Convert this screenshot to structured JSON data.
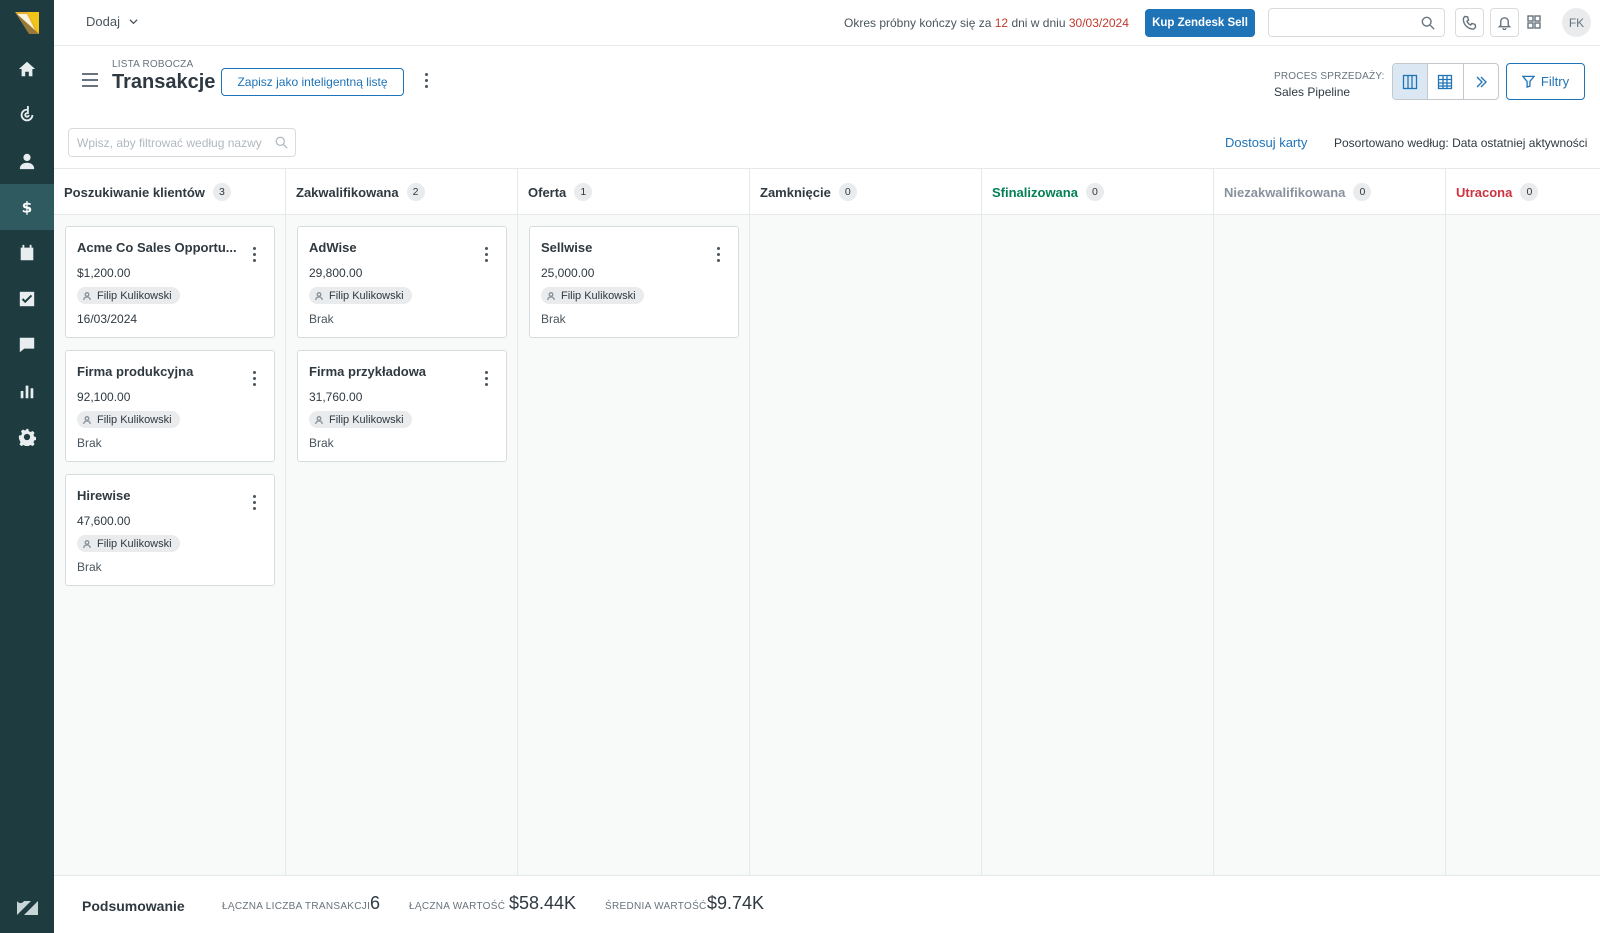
{
  "topbar": {
    "add_label": "Dodaj",
    "trial_prefix": "Okres próbny kończy się za",
    "trial_days": "12",
    "trial_mid": "dni w dniu",
    "trial_date": "30/03/2024",
    "buy_label": "Kup Zendesk Sell",
    "search_placeholder": "",
    "avatar_initials": "FK"
  },
  "header": {
    "kicker": "LISTA ROBOCZA",
    "title": "Transakcje",
    "save_label": "Zapisz jako inteligentną listę",
    "process_label": "PROCES SPRZEDAŻY:",
    "process_value": "Sales Pipeline",
    "filters_label": "Filtry"
  },
  "toolbar": {
    "filter_placeholder": "Wpisz, aby filtrować według nazwy",
    "customize_label": "Dostosuj karty",
    "sorted_label": "Posortowano według: Data ostatniej aktywności"
  },
  "columns": [
    {
      "name": "Poszukiwanie klientów",
      "count": "3",
      "color": "#2f3941"
    },
    {
      "name": "Zakwalifikowana",
      "count": "2",
      "color": "#2f3941"
    },
    {
      "name": "Oferta",
      "count": "1",
      "color": "#2f3941"
    },
    {
      "name": "Zamknięcie",
      "count": "0",
      "color": "#2f3941"
    },
    {
      "name": "Sfinalizowana",
      "count": "0",
      "color": "#038153"
    },
    {
      "name": "Niezakwalifikowana",
      "count": "0",
      "color": "#87929d"
    },
    {
      "name": "Utracona",
      "count": "0",
      "color": "#cc3340"
    }
  ],
  "cards": {
    "c0": [
      {
        "title": "Acme Co Sales Opportu...",
        "value": "$1,200.00",
        "owner": "Filip Kulikowski",
        "meta": "16/03/2024"
      },
      {
        "title": "Firma produkcyjna",
        "value": "92,100.00",
        "owner": "Filip Kulikowski",
        "meta": "Brak"
      },
      {
        "title": "Hirewise",
        "value": "47,600.00",
        "owner": "Filip Kulikowski",
        "meta": "Brak"
      }
    ],
    "c1": [
      {
        "title": "AdWise",
        "value": "29,800.00",
        "owner": "Filip Kulikowski",
        "meta": "Brak"
      },
      {
        "title": "Firma przykładowa",
        "value": "31,760.00",
        "owner": "Filip Kulikowski",
        "meta": "Brak"
      }
    ],
    "c2": [
      {
        "title": "Sellwise",
        "value": "25,000.00",
        "owner": "Filip Kulikowski",
        "meta": "Brak"
      }
    ]
  },
  "summary": {
    "title": "Podsumowanie",
    "count_label": "ŁĄCZNA LICZBA TRANSAKCJI",
    "count_value": "6",
    "total_label": "ŁĄCZNA WARTOŚĆ",
    "total_value": "$58.44K",
    "avg_label": "ŚREDNIA WARTOŚĆ",
    "avg_value": "$9.74K"
  },
  "colors": {
    "sidebar": "#1e3b3f",
    "accent": "#1f73b7",
    "trial_red": "#c0392b"
  }
}
